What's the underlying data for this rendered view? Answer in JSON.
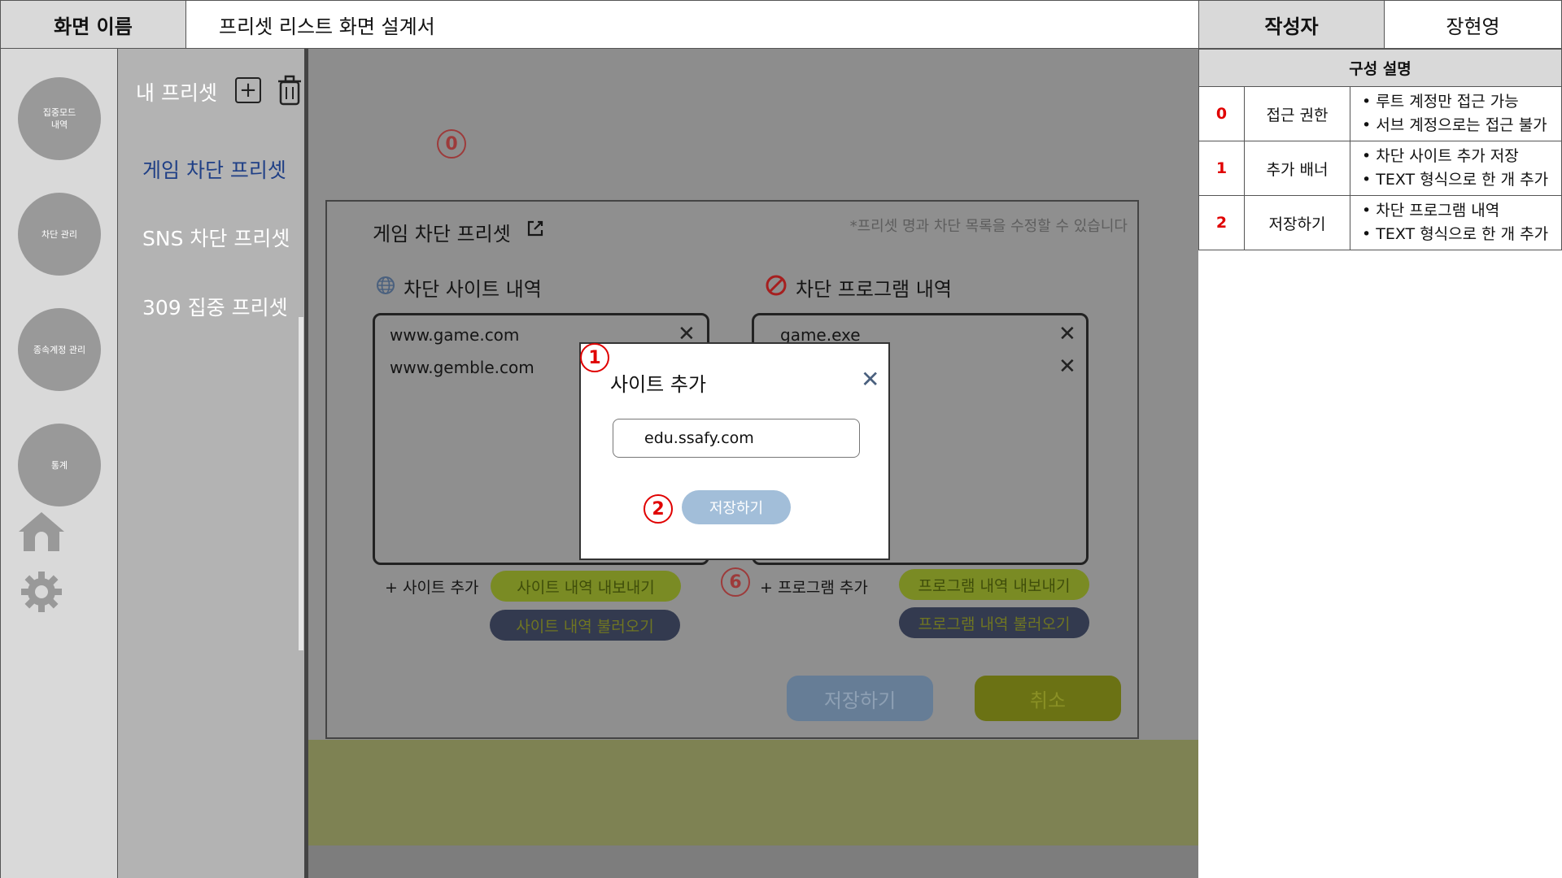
{
  "header": {
    "screen_name_label": "화면 이름",
    "screen_title": "프리셋 리스트 화면 설계서",
    "author_label": "작성자",
    "author": "장현영"
  },
  "rail": {
    "buttons": [
      "집중모드\n내역",
      "차단 관리",
      "종속계정 관리",
      "통계"
    ],
    "icons": [
      "home-icon",
      "gear-icon"
    ]
  },
  "presets": {
    "title": "내 프리셋",
    "items": [
      "게임 차단 프리셋",
      "SNS 차단 프리셋",
      "309 집중 프리셋"
    ],
    "active_index": 0
  },
  "editor": {
    "title": "게임 차단 프리셋",
    "hint": "*프리셋 명과 차단 목록을 수정할 수 있습니다",
    "sites_title": "차단 사이트 내역",
    "sites": [
      "www.game.com",
      "www.gemble.com"
    ],
    "programs_title": "차단 프로그램 내역",
    "programs": [
      "game.exe"
    ],
    "add_site": "+ 사이트 추가",
    "export_sites": "사이트 내역 내보내기",
    "import_sites": "사이트 내역 불러오기",
    "add_program": "+ 프로그램 추가",
    "export_programs": "프로그램 내역 내보내기",
    "import_programs": "프로그램 내역 불러오기",
    "save": "저장하기",
    "cancel": "취소"
  },
  "modal": {
    "title": "사이트 추가",
    "input_value": "edu.ssafy.com",
    "save": "저장하기"
  },
  "annotations": [
    "0",
    "1",
    "2",
    "6"
  ],
  "spec": {
    "header": "구성 설명",
    "rows": [
      {
        "num": "0",
        "name": "접근 권한",
        "desc": [
          "루트 계정만 접근 가능",
          "서브 계정으로는 접근 불가"
        ]
      },
      {
        "num": "1",
        "name": "추가 배너",
        "desc": [
          "차단 사이트 추가 저장",
          "TEXT 형식으로 한 개 추가"
        ]
      },
      {
        "num": "2",
        "name": "저장하기",
        "desc": [
          "차단 프로그램 내역",
          "TEXT 형식으로 한 개 추가"
        ]
      }
    ]
  },
  "colors": {
    "accent_red": "#e00000",
    "active_preset": "#1f3f86",
    "modal_save": "#a2bed9"
  }
}
